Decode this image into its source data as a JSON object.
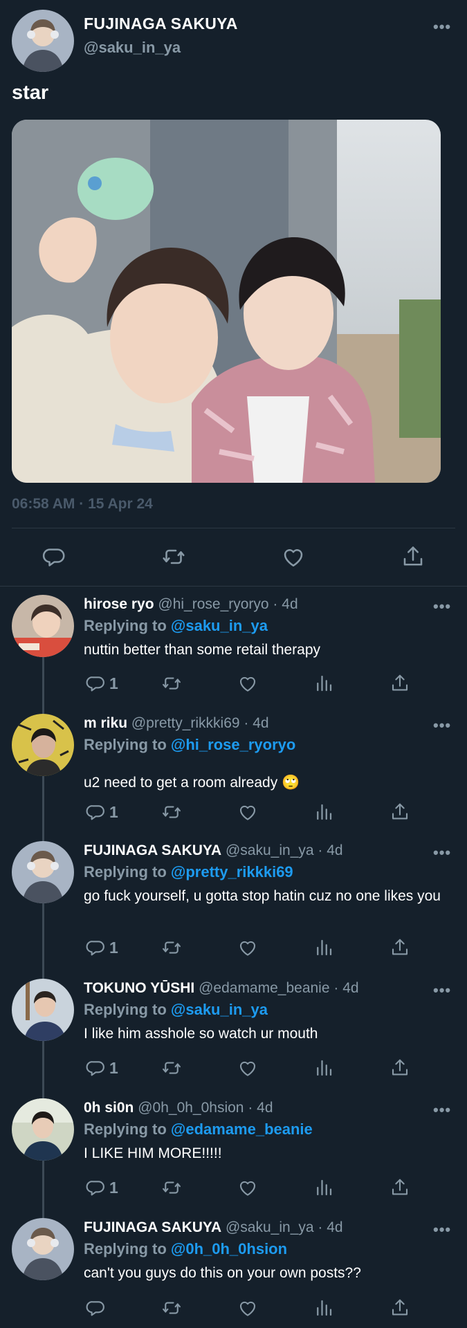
{
  "main_tweet": {
    "display_name": "FUJINAGA SAKUYA",
    "handle": "@saku_in_ya",
    "more": "•••",
    "text": "star",
    "timestamp": "06:58 AM · 15 Apr 24"
  },
  "replies": [
    {
      "display_name": "hirose ryo",
      "meta": " @hi_rose_ryoryo · 4d",
      "replying_prefix": "Replying to ",
      "replying_to": "@saku_in_ya",
      "text": "nuttin better than some retail therapy",
      "reply_count": "1"
    },
    {
      "display_name": "m riku",
      "meta": " @pretty_rikkki69 · 4d",
      "replying_prefix": "Replying to ",
      "replying_to": "@hi_rose_ryoryo",
      "text": "u2 need to get a room already 🙄",
      "reply_count": "1"
    },
    {
      "display_name": "FUJINAGA SAKUYA",
      "meta": " @saku_in_ya · 4d",
      "replying_prefix": "Replying to ",
      "replying_to": "@pretty_rikkki69",
      "text": "go fuck yourself, u gotta stop hatin cuz no one likes you",
      "reply_count": "1"
    },
    {
      "display_name": "TOKUNO YŪSHI",
      "meta": "  @edamame_beanie · 4d",
      "replying_prefix": "Replying to ",
      "replying_to": "@saku_in_ya",
      "text": "I like him asshole so watch ur mouth",
      "reply_count": "1"
    },
    {
      "display_name": "0h si0n",
      "meta": " @0h_0h_0hsion · 4d",
      "replying_prefix": "Replying to ",
      "replying_to": "@edamame_beanie",
      "text": "I LIKE HIM MORE!!!!!",
      "reply_count": "1"
    },
    {
      "display_name": "FUJINAGA SAKUYA",
      "meta": " @saku_in_ya · 4d",
      "replying_prefix": "Replying to ",
      "replying_to": "@0h_0h_0hsion",
      "text": "can't you guys do this on your own posts??",
      "reply_count": ""
    }
  ],
  "icons": {
    "reply": "speech-bubble-icon",
    "retweet": "retweet-icon",
    "like": "heart-icon",
    "views": "bar-chart-icon",
    "share": "share-icon"
  },
  "colors": {
    "background": "#15202b",
    "muted": "#8899a6",
    "mention": "#1d9bf0",
    "divider": "#2c3844"
  }
}
